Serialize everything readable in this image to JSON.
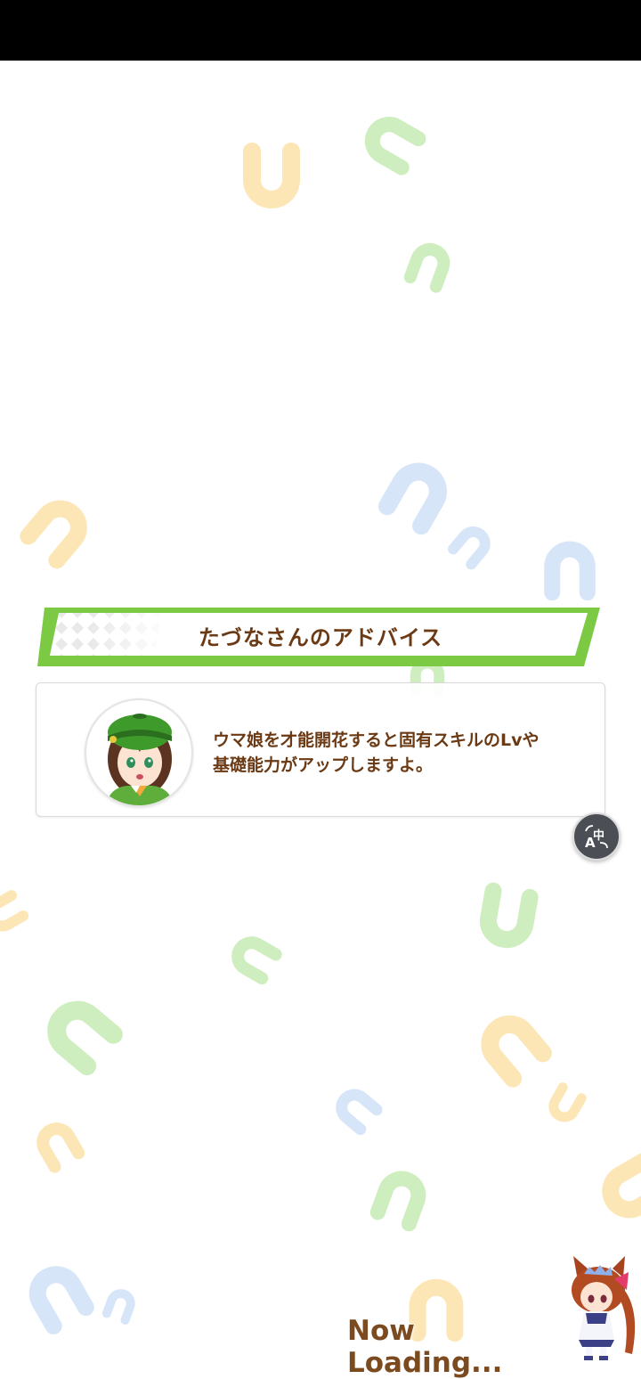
{
  "status_bar": {
    "color": "#000000"
  },
  "tip": {
    "title": "たづなさんのアドバイス",
    "lines": [
      "ウマ娘を才能開花すると固有スキルのLvや",
      "基礎能力がアップしますよ。"
    ],
    "avatar_icon": "character-portrait-icon"
  },
  "translate_button": {
    "icon": "translate-icon"
  },
  "loading": {
    "text": "Now Loading..."
  },
  "colors": {
    "accent_green": "#7cc943",
    "text_brown": "#6b3a14",
    "horseshoe_orange": "#fbd689",
    "horseshoe_green": "#b9e6a3",
    "horseshoe_blue": "#c3d7f6"
  }
}
